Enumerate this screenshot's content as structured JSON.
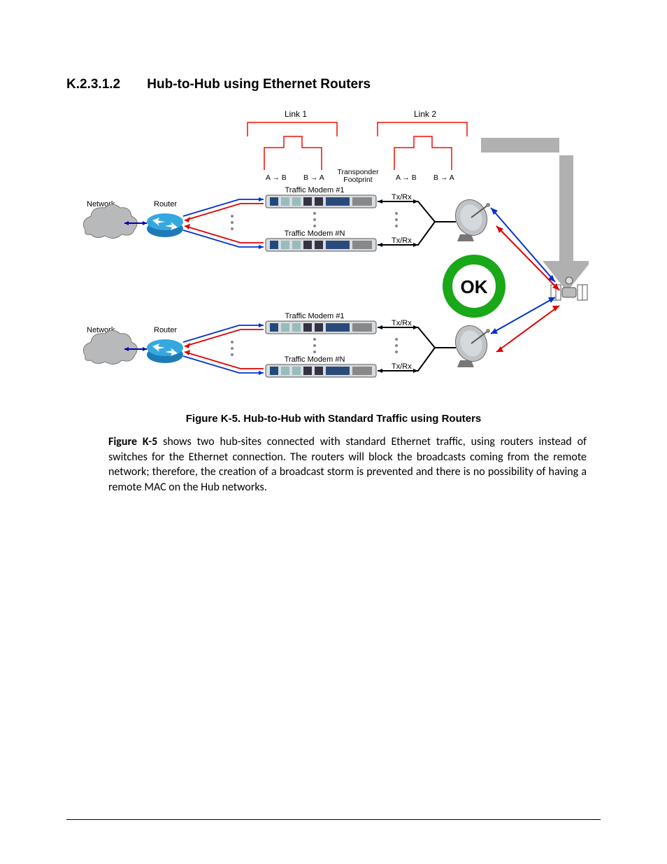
{
  "heading": {
    "number": "K.2.3.1.2",
    "title": "Hub-to-Hub using Ethernet Routers"
  },
  "caption": "Figure K-5. Hub-to-Hub with Standard Traffic using Routers",
  "paragraph_lead": "Figure K-5",
  "paragraph_rest": " shows two hub-sites connected with standard Ethernet traffic, using routers instead of switches for the Ethernet connection. The routers will block the broadcasts coming from the remote network; therefore, the creation of a broadcast storm is prevented and there is no possibility of having a remote MAC on the Hub networks.",
  "diagram": {
    "link1": "Link 1",
    "link2": "Link 2",
    "transponder": "Transponder\nFootprint",
    "ab": "A → B",
    "ba": "B → A",
    "network": "Network",
    "router": "Router",
    "modem1": "Traffic Modem #1",
    "modemN": "Traffic Modem #N",
    "txrx": "Tx/Rx",
    "ok": "OK"
  }
}
